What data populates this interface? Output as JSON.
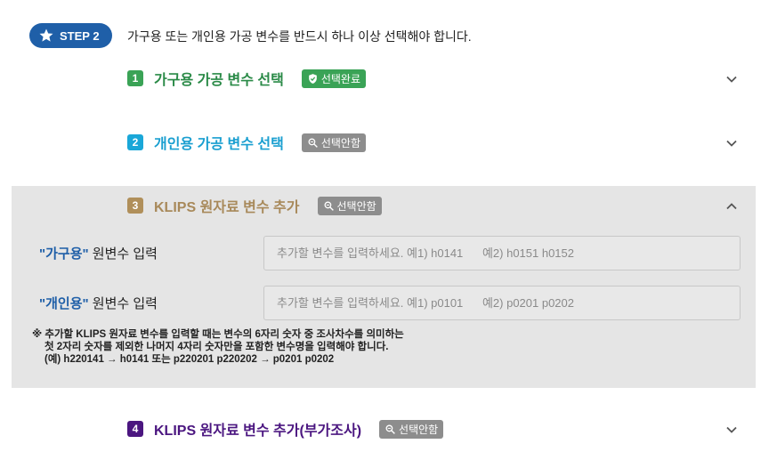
{
  "step": {
    "badge_label": "STEP 2",
    "description": "가구용 또는 개인용 가공 변수를 반드시 하나 이상 선택해야 합니다."
  },
  "sections": [
    {
      "number": "1",
      "title": "가구용 가공 변수 선택",
      "tag": "선택완료",
      "tag_icon": "shield-check-icon",
      "chevron": "chevron-down-icon",
      "color": "#3aa356"
    },
    {
      "number": "2",
      "title": "개인용 가공 변수 선택",
      "tag": "선택안함",
      "tag_icon": "search-icon",
      "chevron": "chevron-down-icon",
      "color": "#1aa7d8"
    },
    {
      "number": "3",
      "title": "KLIPS 원자료 변수 추가",
      "tag": "선택안함",
      "tag_icon": "search-icon",
      "chevron": "chevron-up-icon",
      "color": "#b08f5a"
    },
    {
      "number": "4",
      "title": "KLIPS 원자료 변수 추가(부가조사)",
      "tag": "선택안함",
      "tag_icon": "search-icon",
      "chevron": "chevron-down-icon",
      "color": "#4b1680"
    }
  ],
  "klips": {
    "household": {
      "label_highlight": "\"가구용\"",
      "label_rest": " 원변수 입력",
      "placeholder": "추가할 변수를 입력하세요. 예1) h0141      예2) h0151 h0152"
    },
    "individual": {
      "label_highlight": "\"개인용\"",
      "label_rest": " 원변수 입력",
      "placeholder": "추가할 변수를 입력하세요. 예1) p0101      예2) p0201 p0202"
    },
    "note": {
      "line1": "※ 추가할 KLIPS 원자료 변수를 입력할 때는 변수의 6자리 숫자 중 조사차수를 의미하는",
      "line2": "첫 2자리 숫자를 제외한 나머지 4자리 숫자만을 포함한 변수명을 입력해야 합니다.",
      "line3": "(예) h220141 → h0141 또는 p220201 p220202 → p0201 p0202"
    }
  }
}
